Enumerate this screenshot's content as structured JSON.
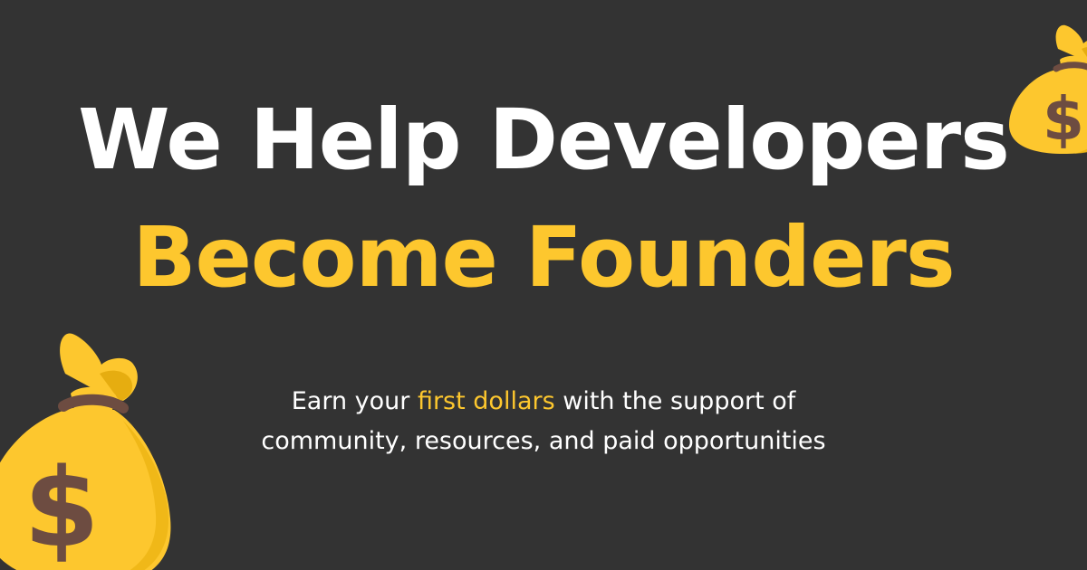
{
  "headline": {
    "line1": "We Help Developers",
    "line2": "Become Founders"
  },
  "subtitle": {
    "part1": "Earn your ",
    "highlight": "first dollars",
    "part2": " with the support of",
    "line2": "community, resources, and paid opportunities"
  },
  "colors": {
    "background": "#333333",
    "accent": "#fdc72e",
    "text": "#ffffff",
    "bag_strap": "#6d4c41"
  },
  "decorations": {
    "large_bag_icon": "money-bag-icon",
    "small_bag_icon": "money-bag-icon"
  }
}
